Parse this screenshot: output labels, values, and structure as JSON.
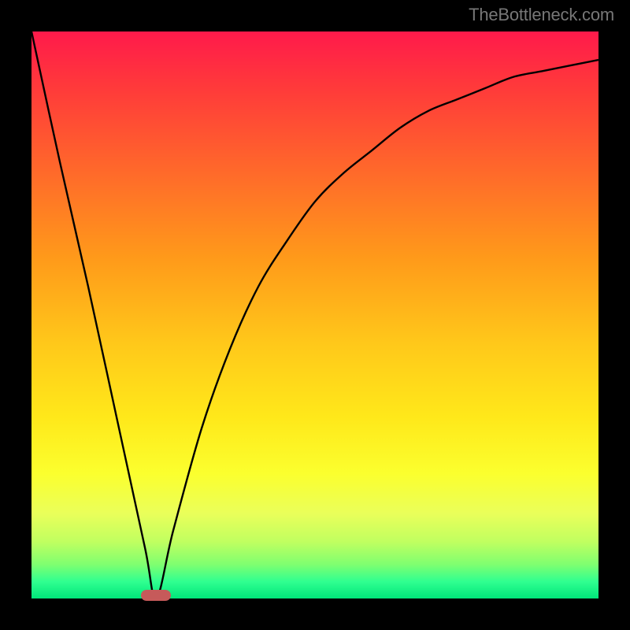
{
  "watermark": "TheBottleneck.com",
  "chart_data": {
    "type": "line",
    "title": "",
    "xlabel": "",
    "ylabel": "",
    "xlim": [
      0,
      100
    ],
    "ylim": [
      0,
      100
    ],
    "grid": false,
    "legend": false,
    "background_gradient": {
      "top_color": "#ff1a4b",
      "bottom_color": "#00e67a",
      "direction": "vertical"
    },
    "series": [
      {
        "name": "bottleneck-curve",
        "color": "#000000",
        "x": [
          0,
          5,
          10,
          15,
          20,
          22,
          25,
          30,
          35,
          40,
          45,
          50,
          55,
          60,
          65,
          70,
          75,
          80,
          85,
          90,
          95,
          100
        ],
        "values": [
          100,
          77,
          55,
          32,
          9,
          0,
          12,
          30,
          44,
          55,
          63,
          70,
          75,
          79,
          83,
          86,
          88,
          90,
          92,
          93,
          94,
          95
        ]
      }
    ],
    "marker": {
      "x": 22,
      "y": 0.5,
      "color": "#c65a5a",
      "shape": "pill"
    },
    "frame_color": "#000000"
  }
}
